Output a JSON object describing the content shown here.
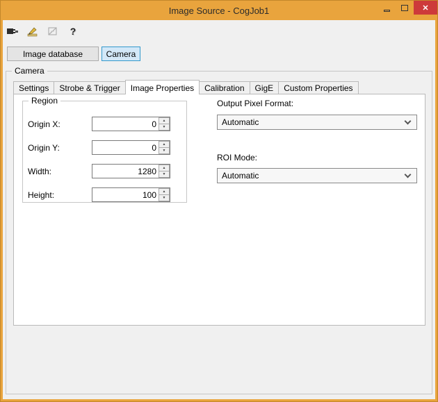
{
  "window": {
    "title": "Image Source - CogJob1"
  },
  "titlebar": {
    "buttons": [
      "minimize",
      "maximize",
      "close"
    ],
    "close_glyph": "✕"
  },
  "toolbar": {
    "icons": [
      "connect-icon",
      "setup-pencil-icon",
      "abort-disabled-icon",
      "help-icon"
    ]
  },
  "source_selector": {
    "image_database_label": "Image database",
    "camera_label": "Camera"
  },
  "camera_group": {
    "label": "Camera"
  },
  "tabs": [
    {
      "label": "Settings",
      "active": false
    },
    {
      "label": "Strobe & Trigger",
      "active": false
    },
    {
      "label": "Image Properties",
      "active": true
    },
    {
      "label": "Calibration",
      "active": false
    },
    {
      "label": "GigE",
      "active": false
    },
    {
      "label": "Custom Properties",
      "active": false
    }
  ],
  "region": {
    "label": "Region",
    "fields": [
      {
        "label": "Origin X:",
        "value": "0"
      },
      {
        "label": "Origin Y:",
        "value": "0"
      },
      {
        "label": "Width:",
        "value": "1280"
      },
      {
        "label": "Height:",
        "value": "100"
      }
    ]
  },
  "format_panel": {
    "output_pixel_format_label": "Output Pixel Format:",
    "output_pixel_format_value": "Automatic",
    "roi_mode_label": "ROI Mode:",
    "roi_mode_value": "Automatic"
  },
  "colors": {
    "titlebar": "#e9a43d",
    "close_button": "#cd3a3a",
    "selected_button_bg": "#d3e8f8",
    "selected_button_border": "#3399cc",
    "window_bg": "#f0f0f0"
  }
}
